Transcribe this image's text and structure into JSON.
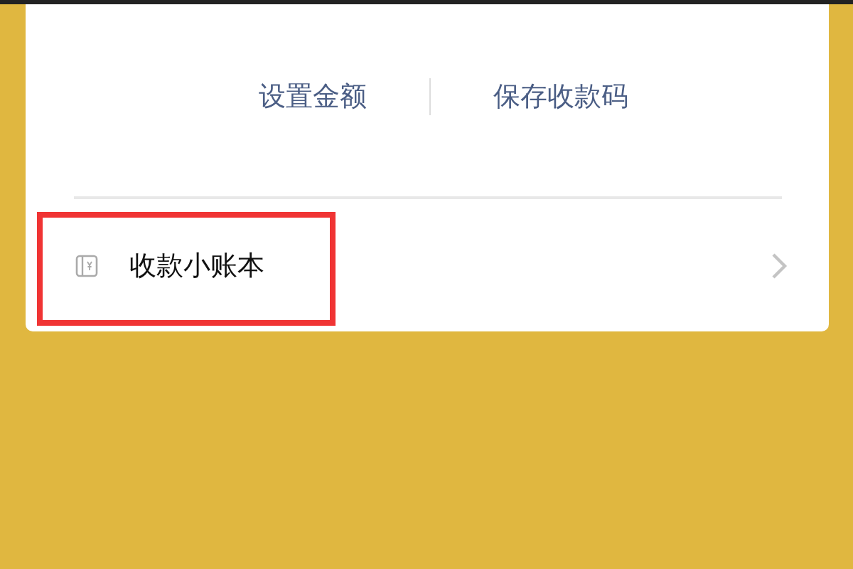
{
  "actions": [
    {
      "label": "设置金额"
    },
    {
      "label": "保存收款码"
    }
  ],
  "menu_items": [
    {
      "label": "收款小账本",
      "highlighted": true
    }
  ]
}
